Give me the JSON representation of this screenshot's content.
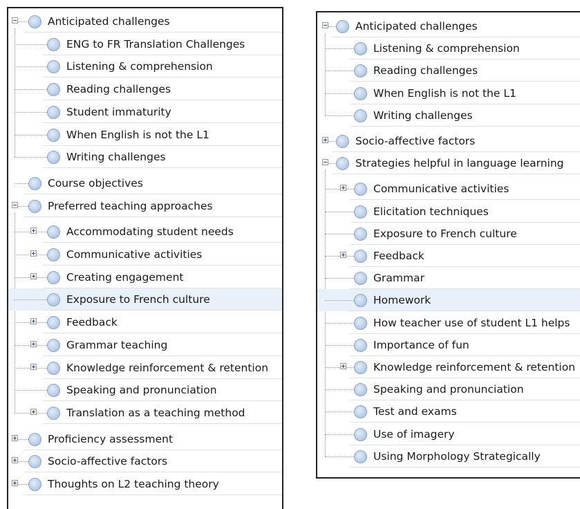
{
  "left_panel": {
    "items": [
      {
        "label": "Anticipated challenges",
        "level": 0,
        "expander": "minus"
      },
      {
        "label": "ENG to FR Translation Challenges",
        "level": 1,
        "expander": "none"
      },
      {
        "label": "Listening & comprehension",
        "level": 1,
        "expander": "none"
      },
      {
        "label": "Reading challenges",
        "level": 1,
        "expander": "none"
      },
      {
        "label": "Student immaturity",
        "level": 1,
        "expander": "none"
      },
      {
        "label": "When English is not the L1",
        "level": 1,
        "expander": "none"
      },
      {
        "label": "Writing challenges",
        "level": 1,
        "expander": "none"
      },
      {
        "label": "Course objectives",
        "level": 0,
        "expander": "none"
      },
      {
        "label": "Preferred teaching approaches",
        "level": 0,
        "expander": "minus"
      },
      {
        "label": "Accommodating student needs",
        "level": 1,
        "expander": "plus"
      },
      {
        "label": "Communicative activities",
        "level": 1,
        "expander": "plus"
      },
      {
        "label": "Creating engagement",
        "level": 1,
        "expander": "plus"
      },
      {
        "label": "Exposure to French culture",
        "level": 1,
        "expander": "none",
        "highlighted": true
      },
      {
        "label": "Feedback",
        "level": 1,
        "expander": "plus"
      },
      {
        "label": "Grammar teaching",
        "level": 1,
        "expander": "plus"
      },
      {
        "label": "Knowledge reinforcement & retention",
        "level": 1,
        "expander": "plus"
      },
      {
        "label": "Speaking and pronunciation",
        "level": 1,
        "expander": "none"
      },
      {
        "label": "Translation as a teaching method",
        "level": 1,
        "expander": "plus"
      },
      {
        "label": "Proficiency assessment",
        "level": 0,
        "expander": "plus"
      },
      {
        "label": "Socio-affective factors",
        "level": 0,
        "expander": "plus"
      },
      {
        "label": "Thoughts on L2 teaching theory",
        "level": 0,
        "expander": "plus"
      }
    ]
  },
  "right_panel": {
    "items": [
      {
        "label": "Anticipated challenges",
        "level": 0,
        "expander": "minus"
      },
      {
        "label": "Listening & comprehension",
        "level": 1,
        "expander": "none"
      },
      {
        "label": "Reading challenges",
        "level": 1,
        "expander": "none"
      },
      {
        "label": "When English is not the L1",
        "level": 1,
        "expander": "none"
      },
      {
        "label": "Writing challenges",
        "level": 1,
        "expander": "none"
      },
      {
        "label": "Socio-affective factors",
        "level": 0,
        "expander": "plus"
      },
      {
        "label": "Strategies helpful in language learning",
        "level": 0,
        "expander": "minus"
      },
      {
        "label": "Communicative activities",
        "level": 1,
        "expander": "plus"
      },
      {
        "label": "Elicitation techniques",
        "level": 1,
        "expander": "none"
      },
      {
        "label": "Exposure to French culture",
        "level": 1,
        "expander": "none"
      },
      {
        "label": "Feedback",
        "level": 1,
        "expander": "plus"
      },
      {
        "label": "Grammar",
        "level": 1,
        "expander": "none"
      },
      {
        "label": "Homework",
        "level": 1,
        "expander": "none",
        "highlighted": true
      },
      {
        "label": "How teacher use of student L1 helps",
        "level": 1,
        "expander": "none"
      },
      {
        "label": "Importance of fun",
        "level": 1,
        "expander": "none"
      },
      {
        "label": "Knowledge reinforcement & retention",
        "level": 1,
        "expander": "plus"
      },
      {
        "label": "Speaking and pronunciation",
        "level": 1,
        "expander": "none"
      },
      {
        "label": "Test and exams",
        "level": 1,
        "expander": "none"
      },
      {
        "label": "Use of imagery",
        "level": 1,
        "expander": "none"
      },
      {
        "label": "Using Morphology Strategically",
        "level": 1,
        "expander": "none"
      }
    ]
  },
  "colors": {
    "highlight": "#e8f1fa",
    "node_fill": "#bdd1ea",
    "node_border": "#8aa5c8",
    "expander_sign": "#2c4a7a"
  }
}
